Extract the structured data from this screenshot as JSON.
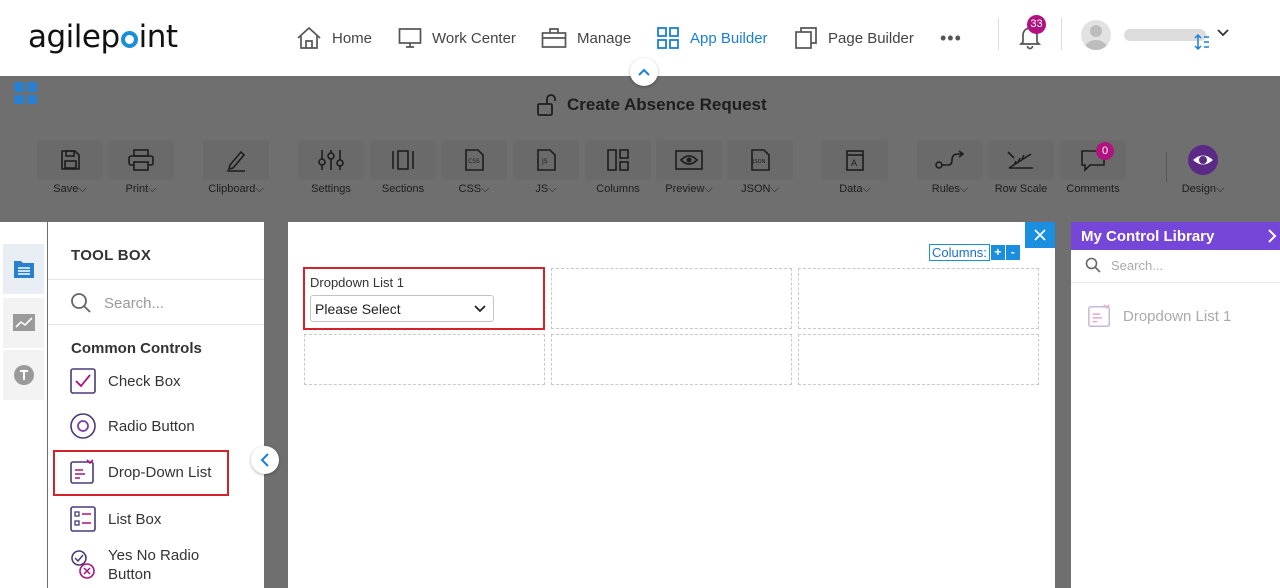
{
  "app": {
    "logo_text": "agilepoint",
    "notification_count": "33"
  },
  "nav": {
    "items": [
      {
        "label": "Home"
      },
      {
        "label": "Work Center"
      },
      {
        "label": "Manage"
      },
      {
        "label": "App Builder"
      },
      {
        "label": "Page Builder"
      }
    ],
    "more": "•••"
  },
  "form": {
    "title": "Create Absence Request"
  },
  "toolbar": {
    "items": [
      {
        "label": "Save",
        "icon": "save-icon",
        "dropdown": true
      },
      {
        "label": "Print",
        "icon": "print-icon",
        "dropdown": true
      },
      {
        "label": "Clipboard",
        "icon": "pencil-icon",
        "dropdown": true
      },
      {
        "label": "Settings",
        "icon": "sliders-icon",
        "dropdown": false
      },
      {
        "label": "Sections",
        "icon": "sections-icon",
        "dropdown": false
      },
      {
        "label": "CSS",
        "icon": "css-file-icon",
        "dropdown": true
      },
      {
        "label": "JS",
        "icon": "js-file-icon",
        "dropdown": true
      },
      {
        "label": "Columns",
        "icon": "columns-icon",
        "dropdown": false
      },
      {
        "label": "Preview",
        "icon": "eye-icon",
        "dropdown": true
      },
      {
        "label": "JSON",
        "icon": "json-file-icon",
        "dropdown": true
      },
      {
        "label": "Data",
        "icon": "data-icon",
        "dropdown": true
      },
      {
        "label": "Rules",
        "icon": "rules-icon",
        "dropdown": true
      },
      {
        "label": "Row Scale",
        "icon": "row-scale-icon",
        "dropdown": false
      },
      {
        "label": "Comments",
        "icon": "comment-icon",
        "dropdown": false
      },
      {
        "label": "Design",
        "icon": "design-eye-icon",
        "dropdown": true
      }
    ],
    "comments_count": "0"
  },
  "toolbox": {
    "title": "TOOL BOX",
    "search_placeholder": "Search...",
    "category": "Common Controls",
    "controls": [
      {
        "label": "Check Box"
      },
      {
        "label": "Radio Button"
      },
      {
        "label": "Drop-Down List"
      },
      {
        "label": "List Box"
      },
      {
        "label": "Yes No Radio Button"
      }
    ]
  },
  "canvas": {
    "columns_label": "Columns:",
    "plus": "+",
    "minus": "-",
    "dropdown_label": "Dropdown List 1",
    "dropdown_value": "Please Select"
  },
  "library": {
    "title": "My Control Library",
    "search_placeholder": "Search...",
    "items": [
      {
        "label": "Dropdown List 1"
      }
    ]
  },
  "colors": {
    "accent_blue": "#1a8fe0",
    "nav_active": "#1a7fd6",
    "library_header": "#7546d8",
    "badge": "#b0127f",
    "highlight_red": "#d2232a"
  }
}
